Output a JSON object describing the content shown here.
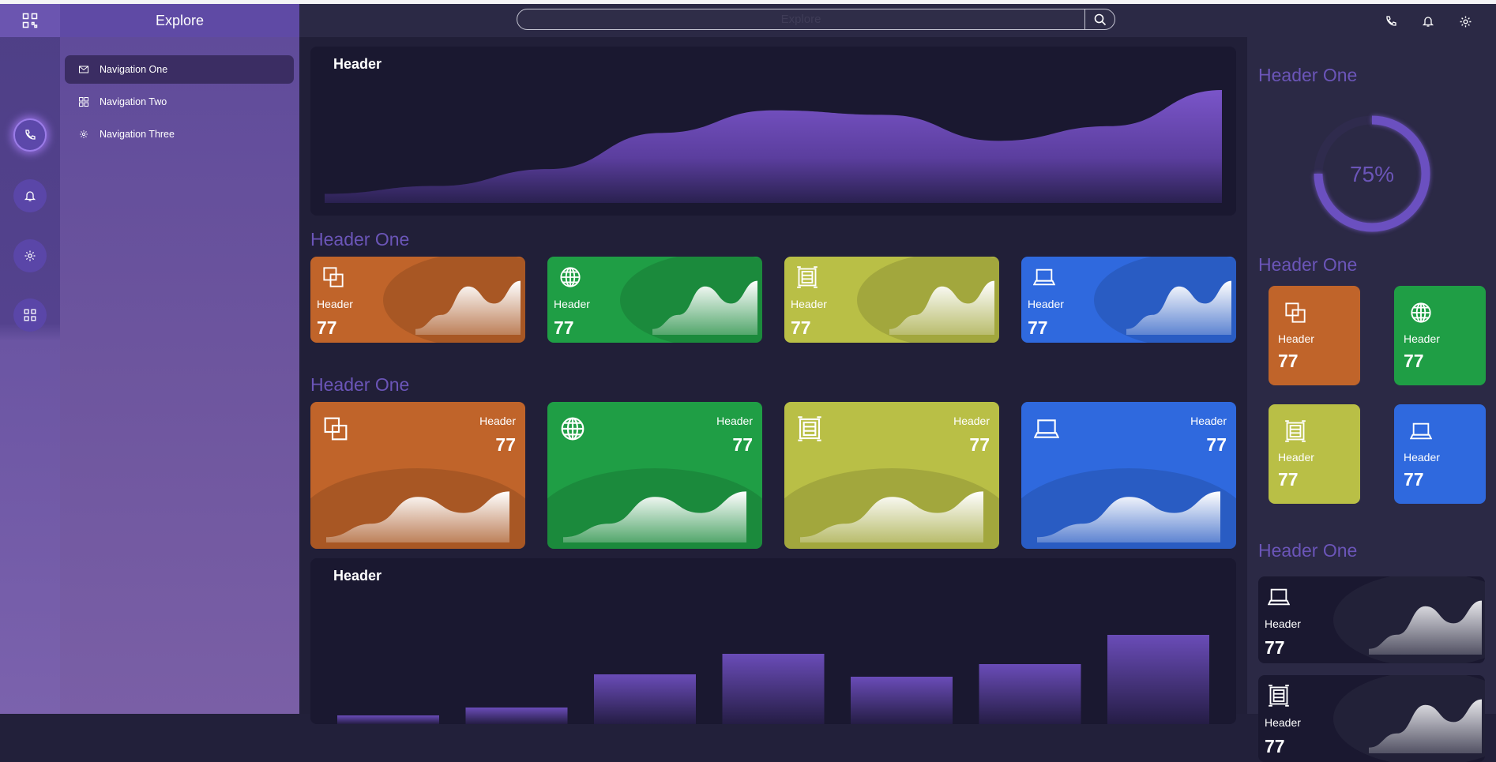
{
  "nav_panel": {
    "title": "Explore",
    "items": [
      {
        "label": "Navigation One",
        "icon": "mail-icon"
      },
      {
        "label": "Navigation Two",
        "icon": "grid-icon"
      },
      {
        "label": "Navigation Three",
        "icon": "gear-icon"
      }
    ]
  },
  "rail": {
    "buttons": [
      "phone-icon",
      "bell-icon",
      "gear-icon",
      "qr-icon"
    ]
  },
  "search": {
    "placeholder": "Explore"
  },
  "main": {
    "area_panel": {
      "title": "Header"
    },
    "section1": {
      "title": "Header One"
    },
    "section2": {
      "title": "Header One"
    },
    "bar_panel": {
      "title": "Header"
    }
  },
  "cards": {
    "label": "Header",
    "value": "77"
  },
  "colors": {
    "orange": "#c0642a",
    "green": "#1f9e45",
    "olive": "#b9bf46",
    "blue": "#2f69de",
    "accent": "#6b55b8"
  },
  "right_panel": {
    "gauge_title": "Header One",
    "gauge_text": "75%",
    "gauge_percent": 75,
    "tiles_title": "Header One",
    "list_title": "Header One"
  },
  "chart_data": [
    {
      "type": "area",
      "title": "Header",
      "x": [
        0,
        1,
        2,
        3,
        4,
        5,
        6,
        7,
        8
      ],
      "values": [
        8,
        15,
        30,
        62,
        82,
        78,
        55,
        68,
        100
      ]
    },
    {
      "type": "bar",
      "title": "Header",
      "categories": [
        "1",
        "2",
        "3",
        "4",
        "5",
        "6",
        "7"
      ],
      "values": [
        11,
        21,
        63,
        89,
        60,
        76,
        113
      ]
    }
  ]
}
